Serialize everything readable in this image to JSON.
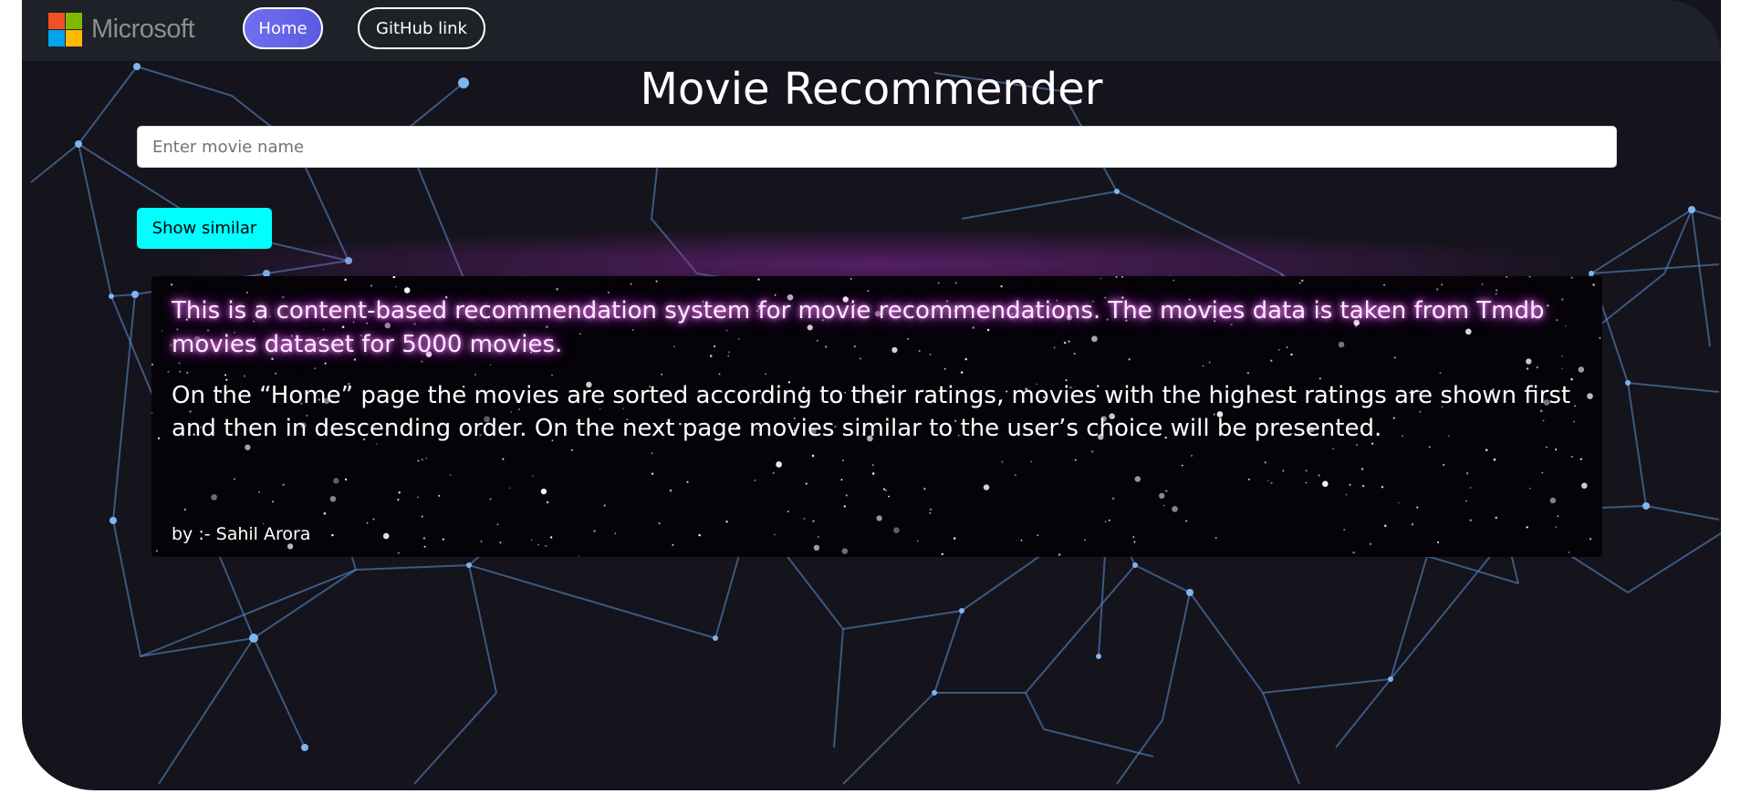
{
  "navbar": {
    "logo_text": "Microsoft",
    "logo_colors": [
      "#f25022",
      "#7fba00",
      "#00a4ef",
      "#ffb900"
    ],
    "home_label": "Home",
    "github_label": "GitHub link"
  },
  "main": {
    "title": "Movie Recommender",
    "search_placeholder": "Enter movie name",
    "search_value": "",
    "show_similar_label": "Show similar"
  },
  "info": {
    "paragraph1": "This is a content-based recommendation system for movie recommendations. The movies data is taken from Tmdb movies dataset for 5000 movies.",
    "paragraph2": "On the “Home” page the movies are sorted according to their ratings, movies with the highest ratings are shown first and then in descending order. On the next page movies similar to the user’s choice will be presented.",
    "byline": "by :- Sahil Arora"
  },
  "colors": {
    "background": "#15131c",
    "navbar": "#1e2127",
    "accent_button": "#00ffff",
    "home_button": "#6f6ff0",
    "network_lines": "#6aa6e8"
  }
}
